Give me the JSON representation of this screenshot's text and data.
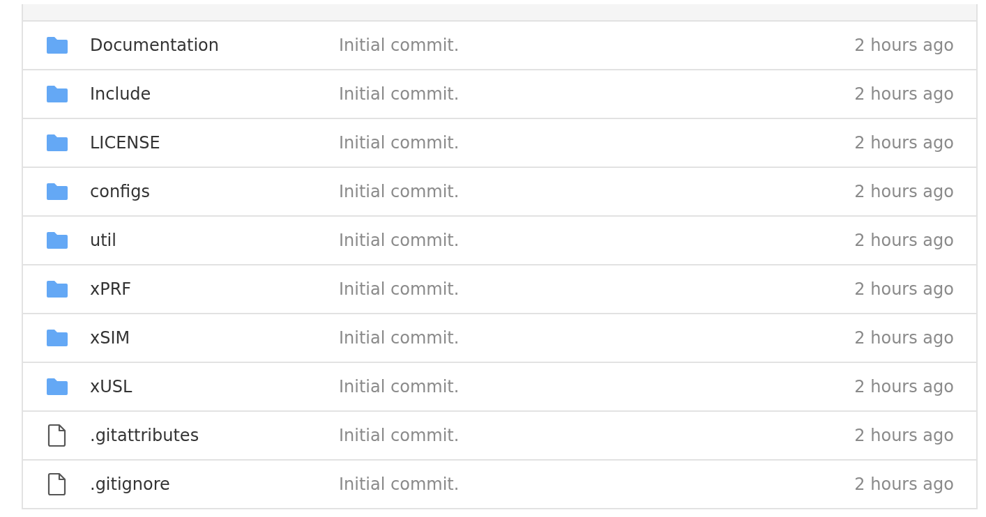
{
  "file_list": {
    "rows": [
      {
        "kind": "folder",
        "name": "Documentation",
        "message": "Initial commit.",
        "time": "2 hours ago"
      },
      {
        "kind": "folder",
        "name": "Include",
        "message": "Initial commit.",
        "time": "2 hours ago"
      },
      {
        "kind": "folder",
        "name": "LICENSE",
        "message": "Initial commit.",
        "time": "2 hours ago"
      },
      {
        "kind": "folder",
        "name": "configs",
        "message": "Initial commit.",
        "time": "2 hours ago"
      },
      {
        "kind": "folder",
        "name": "util",
        "message": "Initial commit.",
        "time": "2 hours ago"
      },
      {
        "kind": "folder",
        "name": "xPRF",
        "message": "Initial commit.",
        "time": "2 hours ago"
      },
      {
        "kind": "folder",
        "name": "xSIM",
        "message": "Initial commit.",
        "time": "2 hours ago"
      },
      {
        "kind": "folder",
        "name": "xUSL",
        "message": "Initial commit.",
        "time": "2 hours ago"
      },
      {
        "kind": "file",
        "name": ".gitattributes",
        "message": "Initial commit.",
        "time": "2 hours ago"
      },
      {
        "kind": "file",
        "name": ".gitignore",
        "message": "Initial commit.",
        "time": "2 hours ago"
      }
    ]
  }
}
